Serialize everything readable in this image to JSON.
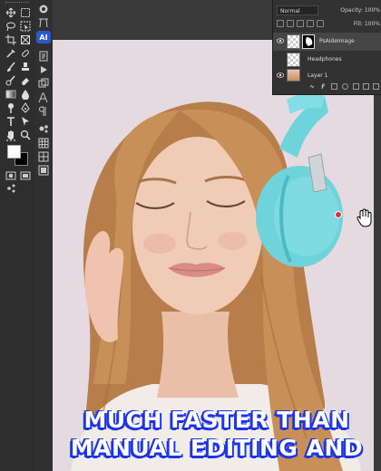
{
  "toolbar": {
    "tools": [
      "move-tool",
      "rect-marquee-tool",
      "lasso-tool",
      "object-select-tool",
      "crop-tool",
      "frame-tool",
      "eyedropper-tool",
      "healing-brush-tool",
      "brush-tool",
      "clone-stamp-tool",
      "history-brush-tool",
      "eraser-tool",
      "gradient-tool",
      "blur-tool",
      "dodge-tool",
      "pen-tool",
      "type-tool",
      "path-select-tool",
      "rectangle-tool",
      "hand-tool",
      "zoom-tool",
      "more-tools"
    ]
  },
  "side_panel": {
    "ai_badge": "AI"
  },
  "layers_panel": {
    "blend_mode": "Normal",
    "opacity_label": "Opacity: 100%",
    "fill_label": "Fill: 100%",
    "layers": [
      {
        "name": "PsAideImage",
        "selected": true,
        "visible": true
      },
      {
        "name": "Headphones",
        "selected": false,
        "visible": false
      },
      {
        "name": "Layer 1",
        "selected": false,
        "visible": true
      }
    ]
  },
  "subtitle": {
    "line1": "MUCH FASTER THAN",
    "line2": "MANUAL EDITING AND"
  },
  "colors": {
    "subtitle_outline": "#1d35e8",
    "headphones": "#6fd3dc",
    "hair": "#c68a55",
    "skin": "#efc9b4",
    "backdrop": "#e4dadf"
  },
  "icons": [
    "eye-icon",
    "lock-icon",
    "link-icon",
    "fx-icon",
    "mask-icon",
    "adjustment-icon",
    "folder-icon",
    "new-layer-icon",
    "trash-icon",
    "hand-cursor-icon"
  ]
}
